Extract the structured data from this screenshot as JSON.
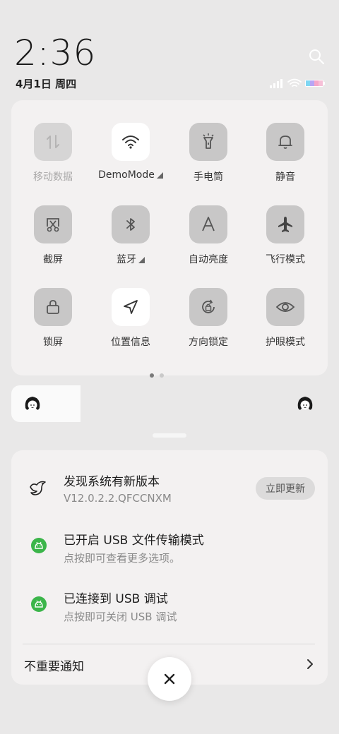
{
  "status": {
    "time": "2:36",
    "date": "4月1日 周四",
    "icons": [
      "signal-icon",
      "wifi-icon",
      "battery-icon"
    ]
  },
  "quick_settings": {
    "tiles": [
      {
        "label": "移动数据",
        "icon": "mobile-data-icon",
        "state": "disabled"
      },
      {
        "label": "DemoMode",
        "icon": "wifi-icon",
        "state": "on",
        "has_menu": true
      },
      {
        "label": "手电筒",
        "icon": "flashlight-icon",
        "state": "off"
      },
      {
        "label": "静音",
        "icon": "bell-icon",
        "state": "off"
      },
      {
        "label": "截屏",
        "icon": "screenshot-icon",
        "state": "off"
      },
      {
        "label": "蓝牙",
        "icon": "bluetooth-icon",
        "state": "off",
        "has_menu": true
      },
      {
        "label": "自动亮度",
        "icon": "auto-brightness-icon",
        "state": "off"
      },
      {
        "label": "飞行模式",
        "icon": "airplane-icon",
        "state": "off"
      },
      {
        "label": "锁屏",
        "icon": "lock-icon",
        "state": "off"
      },
      {
        "label": "位置信息",
        "icon": "location-icon",
        "state": "on"
      },
      {
        "label": "方向锁定",
        "icon": "rotation-lock-icon",
        "state": "off"
      },
      {
        "label": "护眼模式",
        "icon": "eye-icon",
        "state": "off"
      }
    ],
    "page_count": 2,
    "current_page": 1
  },
  "notifications": [
    {
      "title": "发现系统有新版本",
      "subtitle": "V12.0.2.2.QFCCNXM",
      "action": "立即更新",
      "icon": "system-update-icon"
    },
    {
      "title": "已开启 USB 文件传输模式",
      "subtitle": "点按即可查看更多选项。",
      "icon": "android-usb-icon"
    },
    {
      "title": "已连接到 USB 调试",
      "subtitle": "点按即可关闭 USB 调试",
      "icon": "android-usb-icon"
    }
  ],
  "minor_notifications_label": "不重要通知",
  "colors": {
    "accent_green": "#3bb54a",
    "tile_off": "#c8c7c7",
    "tile_on": "#ffffff"
  }
}
